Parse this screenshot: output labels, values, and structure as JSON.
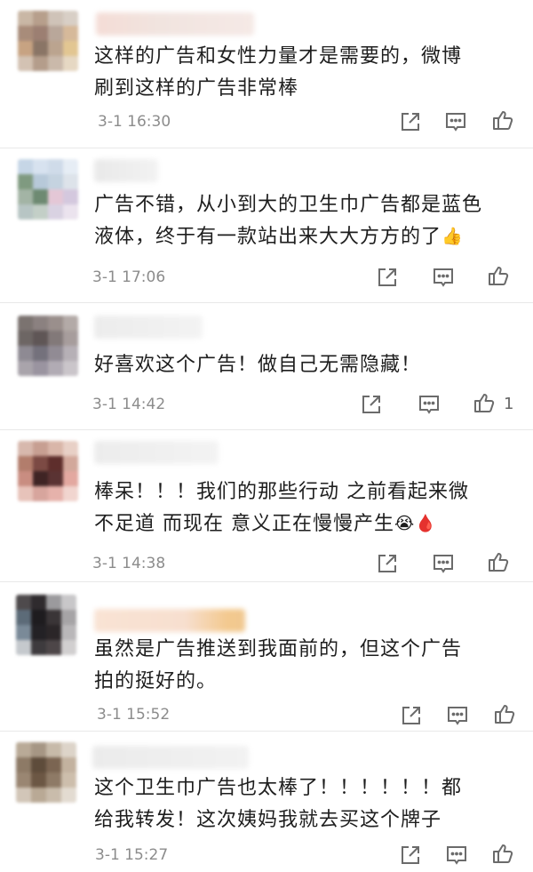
{
  "comments": [
    {
      "text_lines": [
        "这样的广告和女性力量才是需要的，微博",
        "刷到这样的广告非常棒"
      ],
      "time": "3-1 16:30",
      "like_count": ""
    },
    {
      "text_lines": [
        "广告不错，从小到大的卫生巾广告都是蓝色",
        "液体，终于有一款站出来大大方方的了"
      ],
      "trailing_emoji": "👍",
      "time": "3-1 17:06",
      "like_count": ""
    },
    {
      "text_lines": [
        "好喜欢这个广告！做自己无需隐藏！"
      ],
      "time": "3-1 14:42",
      "like_count": "1"
    },
    {
      "text_lines": [
        "棒呆！！！我们的那些行动 之前看起来微",
        "不足道 而现在 意义正在慢慢产生"
      ],
      "trailing_emoji": "😭",
      "trailing_emoji_2": "🩸",
      "time": "3-1 14:38",
      "like_count": ""
    },
    {
      "text_lines": [
        "虽然是广告推送到我面前的，但这个广告",
        "拍的挺好的。"
      ],
      "time": "3-1 15:52",
      "like_count": ""
    },
    {
      "text_lines": [
        "这个卫生巾广告也太棒了！！！！！！都",
        "给我转发！这次姨妈我就去买这个牌子"
      ],
      "time": "3-1 15:27",
      "like_count": ""
    }
  ],
  "icons": {
    "share": "share-icon",
    "comment": "comment-icon",
    "like": "like-icon"
  },
  "colors": {
    "text": "#1e1e1e",
    "meta": "#8c8c8c",
    "icon": "#6b6b6b",
    "divider": "#e8e8e8"
  }
}
